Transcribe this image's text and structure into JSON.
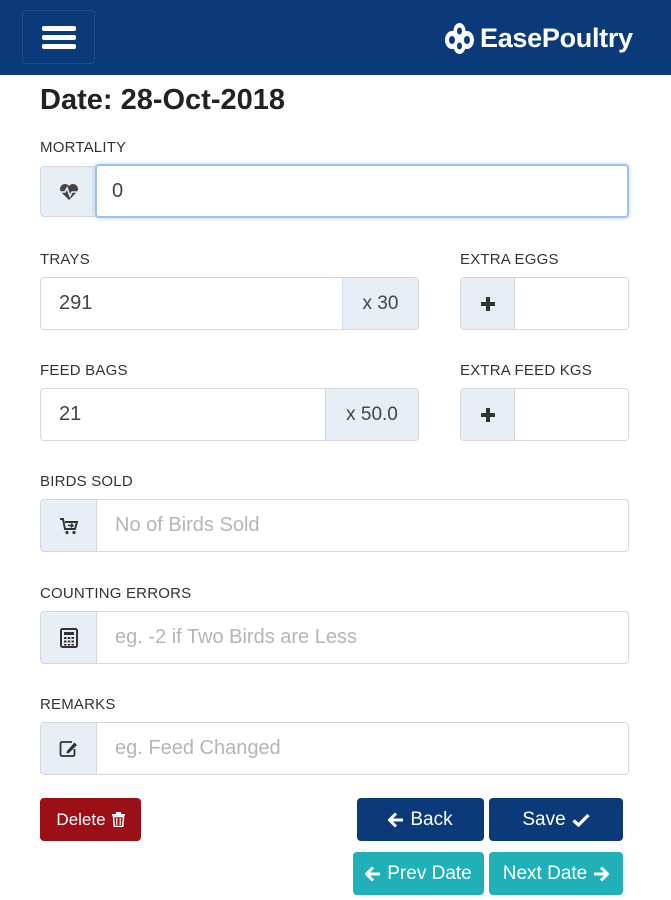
{
  "header": {
    "brand": "EasePoultry",
    "menu_icon": "hamburger-menu-icon"
  },
  "date_title": "Date: 28-Oct-2018",
  "form": {
    "mortality": {
      "label": "MORTALITY",
      "value": "0",
      "icon": "heartbeat-icon"
    },
    "trays": {
      "label": "TRAYS",
      "value": "291",
      "suffix": "x 30"
    },
    "extra_eggs": {
      "label": "EXTRA EGGS",
      "value": "",
      "icon": "plus-icon"
    },
    "feed_bags": {
      "label": "FEED BAGS",
      "value": "21",
      "suffix": "x 50.0"
    },
    "extra_feed_kgs": {
      "label": "EXTRA FEED KGS",
      "value": "",
      "icon": "plus-icon"
    },
    "birds_sold": {
      "label": "BIRDS SOLD",
      "placeholder": "No of Birds Sold",
      "icon": "cart-arrow-icon"
    },
    "counting_errors": {
      "label": "COUNTING ERRORS",
      "placeholder": "eg. -2 if Two Birds are Less",
      "icon": "calculator-icon"
    },
    "remarks": {
      "label": "REMARKS",
      "placeholder": "eg. Feed Changed",
      "icon": "edit-icon"
    }
  },
  "buttons": {
    "delete": "Delete",
    "back": "Back",
    "save": "Save",
    "prev_date": "Prev Date",
    "next_date": "Next Date"
  },
  "colors": {
    "navbar": "#0a3a7a",
    "primary": "#0a3a7a",
    "danger": "#9b0f17",
    "info": "#1fb0b8",
    "addon_bg": "#e8eef5"
  }
}
